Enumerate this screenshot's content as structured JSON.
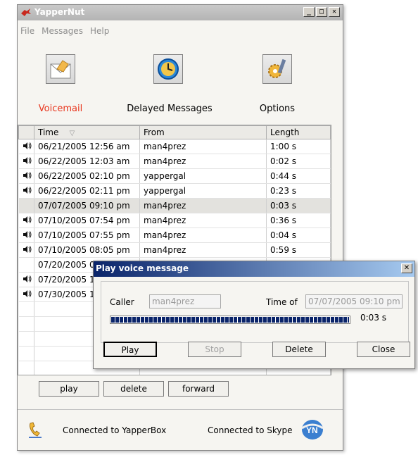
{
  "window": {
    "title": "YapperNut",
    "controls": [
      "minimize",
      "maximize",
      "close"
    ]
  },
  "menu": [
    "File",
    "Messages",
    "Help"
  ],
  "toolbar": {
    "voicemail": "Voicemail",
    "delayed": "Delayed Messages",
    "options": "Options",
    "voicemail_color": "#e8341c"
  },
  "table": {
    "headers": [
      "Time",
      "From",
      "Length"
    ],
    "sort_indicator": "▽",
    "rows": [
      {
        "speaker": true,
        "time": "06/21/2005 12:56 am",
        "from": "man4prez",
        "length": "1:00 s"
      },
      {
        "speaker": true,
        "time": "06/22/2005 12:03 am",
        "from": "man4prez",
        "length": "0:02 s"
      },
      {
        "speaker": true,
        "time": "06/22/2005 02:10 pm",
        "from": "yappergal",
        "length": "0:44 s"
      },
      {
        "speaker": true,
        "time": "06/22/2005 02:11 pm",
        "from": "yappergal",
        "length": "0:23 s"
      },
      {
        "speaker": false,
        "time": "07/07/2005 09:10 pm",
        "from": "man4prez",
        "length": "0:03 s",
        "selected": true
      },
      {
        "speaker": true,
        "time": "07/10/2005 07:54 pm",
        "from": "man4prez",
        "length": "0:36 s"
      },
      {
        "speaker": true,
        "time": "07/10/2005 07:55 pm",
        "from": "man4prez",
        "length": "0:04 s"
      },
      {
        "speaker": true,
        "time": "07/10/2005 08:05 pm",
        "from": "man4prez",
        "length": "0:59 s"
      },
      {
        "speaker": false,
        "time": "07/20/2005 0",
        "from": "",
        "length": ""
      },
      {
        "speaker": true,
        "time": "07/20/2005 1",
        "from": "",
        "length": ""
      },
      {
        "speaker": true,
        "time": "07/30/2005 1",
        "from": "",
        "length": ""
      }
    ],
    "empty_rows": 5
  },
  "actions": {
    "play": "play",
    "delete": "delete",
    "forward": "forward"
  },
  "status": {
    "left": "Connected to YapperBox",
    "right": "Connected to Skype",
    "badge": "YN"
  },
  "dialog": {
    "title": "Play voice message",
    "caller_label": "Caller",
    "caller_value": "man4prez",
    "timeof_label": "Time of",
    "timeof_value": "07/07/2005 09:10 pm",
    "progress_text": "0:03 s",
    "progress_fraction": 1.0,
    "buttons": {
      "play": "Play",
      "stop": "Stop",
      "delete": "Delete",
      "close": "Close"
    }
  }
}
